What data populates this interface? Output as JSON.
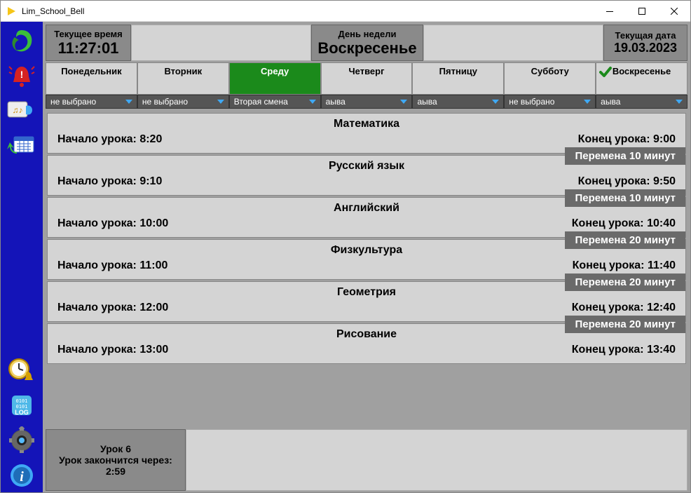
{
  "window": {
    "title": "Lim_School_Bell"
  },
  "header": {
    "time_label": "Текущее время",
    "time_value": "11:27:01",
    "dow_label": "День недели",
    "dow_value": "Воскресенье",
    "date_label": "Текущая дата",
    "date_value": "19.03.2023"
  },
  "days": [
    {
      "label": "Понедельник",
      "active": false,
      "today": false,
      "dropdown": "не выбрано"
    },
    {
      "label": "Вторник",
      "active": false,
      "today": false,
      "dropdown": "не выбрано"
    },
    {
      "label": "Среду",
      "active": true,
      "today": false,
      "dropdown": "Вторая смена"
    },
    {
      "label": "Четверг",
      "active": false,
      "today": false,
      "dropdown": "аыва"
    },
    {
      "label": "Пятницу",
      "active": false,
      "today": false,
      "dropdown": "аыва"
    },
    {
      "label": "Субботу",
      "active": false,
      "today": false,
      "dropdown": "не выбрано"
    },
    {
      "label": "Воскресенье",
      "active": false,
      "today": true,
      "dropdown": "аыва"
    }
  ],
  "lessons": [
    {
      "subject": "Математика",
      "start": "Начало урока: 8:20",
      "end": "Конец урока: 9:00",
      "break_after": ""
    },
    {
      "subject": "Русский язык",
      "start": "Начало урока: 9:10",
      "end": "Конец урока: 9:50",
      "break_after": "Перемена 10 минут"
    },
    {
      "subject": "Английский",
      "start": "Начало урока: 10:00",
      "end": "Конец урока: 10:40",
      "break_after": "Перемена 10 минут"
    },
    {
      "subject": "Физкультура",
      "start": "Начало урока: 11:00",
      "end": "Конец урока: 11:40",
      "break_after": "Перемена 20 минут"
    },
    {
      "subject": "Геометрия",
      "start": "Начало урока: 12:00",
      "end": "Конец урока: 12:40",
      "break_after": "Перемена 20 минут"
    },
    {
      "subject": "Рисование",
      "start": "Начало урока: 13:00",
      "end": "Конец урока: 13:40",
      "break_after": "Перемена 20 минут"
    }
  ],
  "status": {
    "lesson": "Урок 6",
    "countdown_label": "Урок закончится через:",
    "countdown_value": "2:59"
  }
}
